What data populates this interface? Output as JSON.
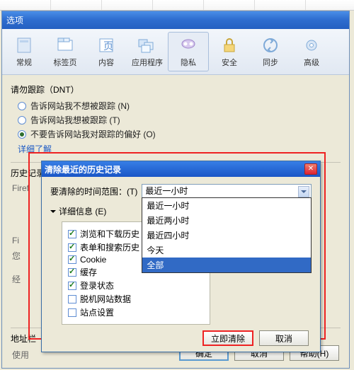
{
  "window": {
    "title": "选项"
  },
  "toolbar": {
    "items": [
      {
        "label": "常规"
      },
      {
        "label": "标签页"
      },
      {
        "label": "内容"
      },
      {
        "label": "应用程序"
      },
      {
        "label": "隐私"
      },
      {
        "label": "安全"
      },
      {
        "label": "同步"
      },
      {
        "label": "高级"
      }
    ]
  },
  "dnt": {
    "heading": "请勿跟踪（DNT）",
    "opt1": "告诉网站我不想被跟踪 (N)",
    "opt2": "告诉网站我想被跟踪 (T)",
    "opt3": "不要告诉网站我对跟踪的偏好 (O)",
    "learn": "详细了解"
  },
  "history": {
    "heading": "历史记录",
    "prefix": "Firef",
    "fi": "Fi",
    "note": "您",
    "jing": "经"
  },
  "addr": {
    "heading": "地址栏",
    "prefix": "使用"
  },
  "buttons": {
    "ok": "确定",
    "cancel": "取消",
    "help": "帮助(H)"
  },
  "dialog": {
    "title": "清除最近的历史记录",
    "range_label": "要清除的时间范围：(T)",
    "range_value": "最近一小时",
    "options": [
      "最近一小时",
      "最近两小时",
      "最近四小时",
      "今天",
      "全部"
    ],
    "details": "详细信息 (E)",
    "checks": [
      {
        "label": "浏览和下载历史",
        "checked": true
      },
      {
        "label": "表单和搜索历史",
        "checked": true
      },
      {
        "label": "Cookie",
        "checked": true
      },
      {
        "label": "缓存",
        "checked": true
      },
      {
        "label": "登录状态",
        "checked": true
      },
      {
        "label": "脱机网站数据",
        "checked": false
      },
      {
        "label": "站点设置",
        "checked": false
      }
    ],
    "clear_now": "立即清除",
    "cancel": "取消"
  }
}
